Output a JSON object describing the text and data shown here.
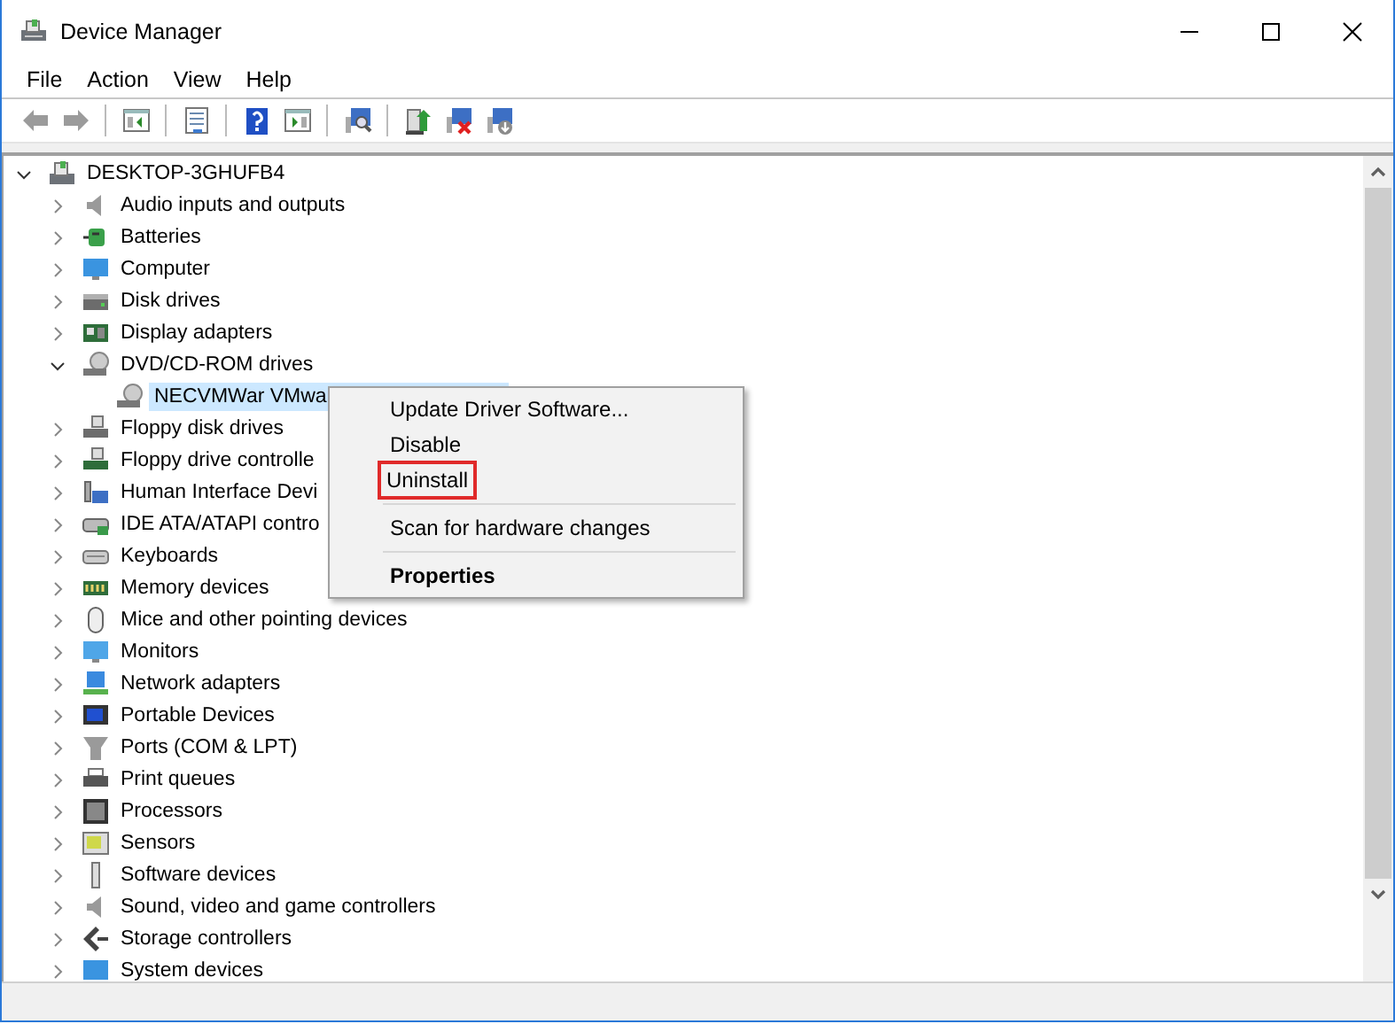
{
  "window": {
    "title": "Device Manager"
  },
  "menu": [
    {
      "label": "File"
    },
    {
      "label": "Action"
    },
    {
      "label": "View"
    },
    {
      "label": "Help"
    }
  ],
  "toolbar": [
    {
      "kind": "back",
      "disabled": true
    },
    {
      "kind": "forward",
      "disabled": true
    },
    {
      "kind": "sep"
    },
    {
      "kind": "tree"
    },
    {
      "kind": "sep"
    },
    {
      "kind": "props"
    },
    {
      "kind": "sep"
    },
    {
      "kind": "help"
    },
    {
      "kind": "pane"
    },
    {
      "kind": "sep"
    },
    {
      "kind": "scan"
    },
    {
      "kind": "sep"
    },
    {
      "kind": "update"
    },
    {
      "kind": "uninstall"
    },
    {
      "kind": "install"
    }
  ],
  "tree": {
    "label": "DESKTOP-3GHUFB4",
    "expanded": true,
    "selected": false,
    "children": [
      {
        "label": "Audio inputs and outputs",
        "expanded": false,
        "selected": false
      },
      {
        "label": "Batteries",
        "expanded": false,
        "selected": false
      },
      {
        "label": "Computer",
        "expanded": false,
        "selected": false
      },
      {
        "label": "Disk drives",
        "expanded": false,
        "selected": false
      },
      {
        "label": "Display adapters",
        "expanded": false,
        "selected": false
      },
      {
        "label": "DVD/CD-ROM drives",
        "expanded": true,
        "selected": false,
        "children": [
          {
            "label": "NECVMWar VMwa",
            "selected": true
          }
        ]
      },
      {
        "label": "Floppy disk drives",
        "expanded": false,
        "selected": false
      },
      {
        "label": "Floppy drive controlle",
        "expanded": false,
        "selected": false
      },
      {
        "label": "Human Interface Devi",
        "expanded": false,
        "selected": false
      },
      {
        "label": "IDE ATA/ATAPI contro",
        "expanded": false,
        "selected": false
      },
      {
        "label": "Keyboards",
        "expanded": false,
        "selected": false
      },
      {
        "label": "Memory devices",
        "expanded": false,
        "selected": false
      },
      {
        "label": "Mice and other pointing devices",
        "expanded": false,
        "selected": false
      },
      {
        "label": "Monitors",
        "expanded": false,
        "selected": false
      },
      {
        "label": "Network adapters",
        "expanded": false,
        "selected": false
      },
      {
        "label": "Portable Devices",
        "expanded": false,
        "selected": false
      },
      {
        "label": "Ports (COM & LPT)",
        "expanded": false,
        "selected": false
      },
      {
        "label": "Print queues",
        "expanded": false,
        "selected": false
      },
      {
        "label": "Processors",
        "expanded": false,
        "selected": false
      },
      {
        "label": "Sensors",
        "expanded": false,
        "selected": false
      },
      {
        "label": "Software devices",
        "expanded": false,
        "selected": false
      },
      {
        "label": "Sound, video and game controllers",
        "expanded": false,
        "selected": false
      },
      {
        "label": "Storage controllers",
        "expanded": false,
        "selected": false
      },
      {
        "label": "System devices",
        "expanded": false,
        "selected": false
      }
    ]
  },
  "context_menu": {
    "items": [
      {
        "kind": "item",
        "label": "Update Driver Software...",
        "outlined": false,
        "default": false
      },
      {
        "kind": "item",
        "label": "Disable",
        "outlined": false,
        "default": false
      },
      {
        "kind": "item",
        "label": "Uninstall",
        "outlined": true,
        "default": false
      },
      {
        "kind": "separator"
      },
      {
        "kind": "item",
        "label": "Scan for hardware changes",
        "outlined": false,
        "default": false
      },
      {
        "kind": "separator"
      },
      {
        "kind": "item",
        "label": "Properties",
        "outlined": false,
        "default": true
      }
    ]
  }
}
